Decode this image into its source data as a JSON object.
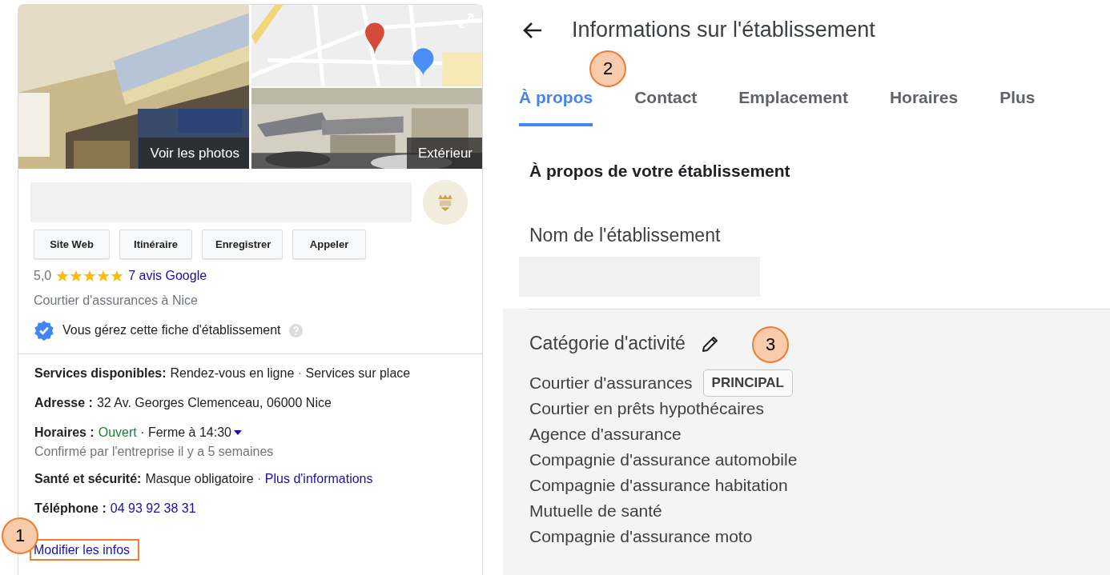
{
  "business_card": {
    "photos": [
      {
        "kind": "picture",
        "caption": "Voir les photos"
      },
      {
        "kind": "picture"
      },
      {
        "kind": "picture",
        "caption": "Extérieur"
      }
    ],
    "actions": [
      "Site Web",
      "Itinéraire",
      "Enregistrer",
      "Appeler"
    ],
    "rating": {
      "score": "5,0",
      "stars": 5,
      "reviews_link": "7 avis Google"
    },
    "category": "Courtier d'assurances à Nice",
    "managed_notice": "Vous gérez cette fiche d'établissement",
    "details": [
      {
        "label": "Services disponibles:",
        "parts": [
          {
            "kind": "text",
            "text": "Rendez-vous en ligne"
          },
          {
            "kind": "sep",
            "text": " · "
          },
          {
            "kind": "text",
            "text": "Services sur place"
          }
        ]
      },
      {
        "label": "Adresse :",
        "parts": [
          {
            "kind": "text",
            "text": "32 Av. Georges Clemenceau, 06000 Nice"
          }
        ]
      },
      {
        "label": "Horaires :",
        "parts": [
          {
            "kind": "status",
            "text": "Ouvert"
          },
          {
            "kind": "text",
            "text": " · Ferme à 14:30"
          },
          {
            "kind": "caret"
          }
        ],
        "note": "Confirmé par l'entreprise il y a 5 semaines"
      },
      {
        "label": "Santé et sécurité:",
        "parts": [
          {
            "kind": "text",
            "text": "Masque obligatoire"
          },
          {
            "kind": "sep",
            "text": " · "
          },
          {
            "kind": "link",
            "text": "Plus d'informations"
          }
        ]
      },
      {
        "label": "Téléphone :",
        "parts": [
          {
            "kind": "link",
            "text": "04 93 92 38 31"
          }
        ]
      }
    ],
    "edit_link": "Modifier les infos"
  },
  "info_panel": {
    "title": "Informations sur l'établissement",
    "tabs": [
      {
        "label": "À propos",
        "selected": true
      },
      {
        "label": "Contact",
        "selected": false
      },
      {
        "label": "Emplacement",
        "selected": false
      },
      {
        "label": "Horaires",
        "selected": false
      },
      {
        "label": "Plus",
        "selected": false
      }
    ],
    "section_title": "À propos de votre établissement",
    "name_label": "Nom de l'établissement",
    "category_title": "Catégorie d'activité",
    "categories": [
      {
        "name": "Courtier d'assurances",
        "badge": "PRINCIPAL"
      },
      {
        "name": "Courtier en prêts hypothécaires"
      },
      {
        "name": "Agence d'assurance"
      },
      {
        "name": "Compagnie d'assurance automobile"
      },
      {
        "name": "Compagnie d'assurance habitation"
      },
      {
        "name": "Mutuelle de santé"
      },
      {
        "name": "Compagnie d'assurance moto"
      }
    ]
  },
  "annotations": [
    {
      "kind": "step",
      "label": "1"
    },
    {
      "kind": "step",
      "label": "2"
    },
    {
      "kind": "step",
      "label": "3"
    }
  ]
}
